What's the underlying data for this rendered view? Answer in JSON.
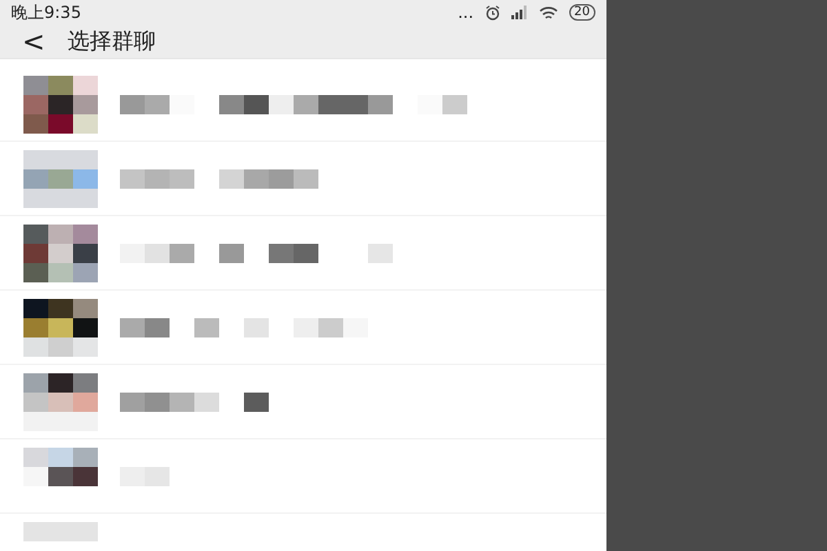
{
  "status_bar": {
    "time": "晚上9:35",
    "more": "...",
    "battery": "20"
  },
  "header": {
    "back": "<",
    "title": "选择群聊"
  },
  "group_chats": [
    {
      "kind": "pixelated"
    },
    {
      "kind": "pixelated"
    },
    {
      "kind": "pixelated"
    },
    {
      "kind": "pixelated"
    },
    {
      "kind": "pixelated"
    },
    {
      "kind": "pixelated"
    },
    {
      "kind": "pixelated"
    }
  ]
}
